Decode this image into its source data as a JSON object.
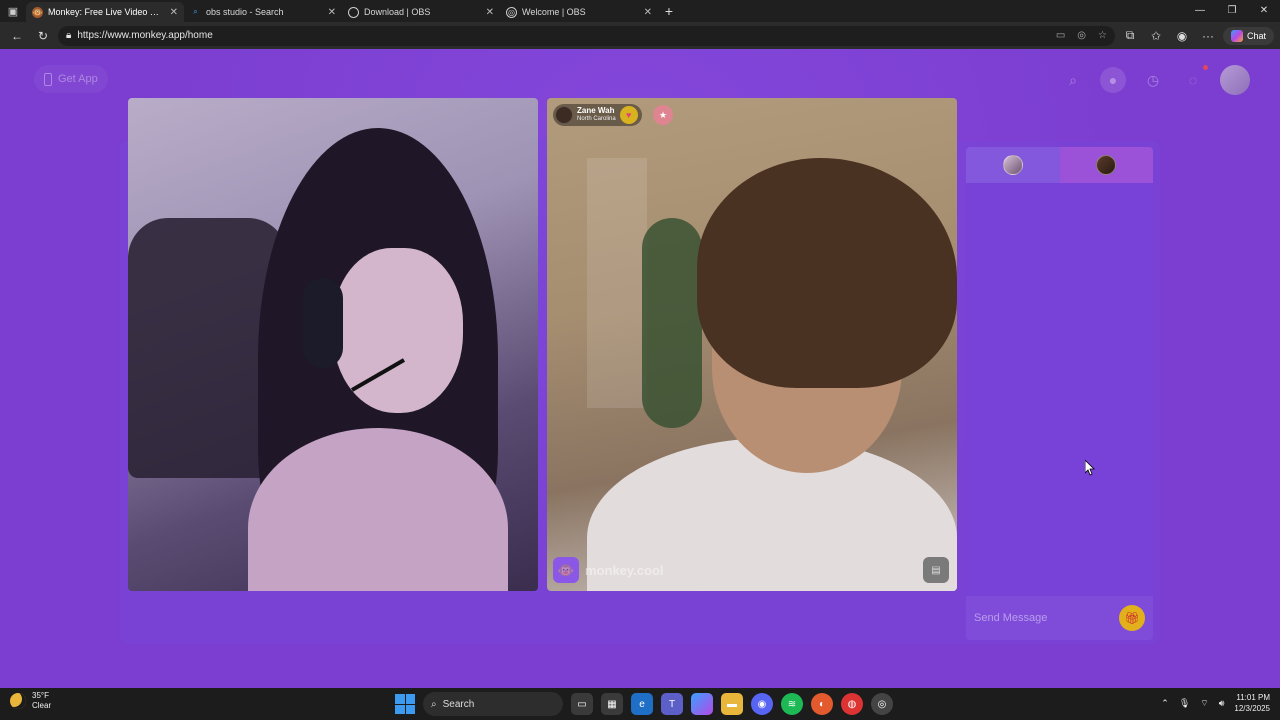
{
  "browser": {
    "tabs": [
      {
        "title": "Monkey: Free Live Video Chat",
        "active": true
      },
      {
        "title": "obs studio - Search",
        "active": false
      },
      {
        "title": "Download | OBS",
        "active": false
      },
      {
        "title": "Welcome | OBS",
        "active": false
      }
    ],
    "url": "https://www.monkey.app/home",
    "chat_label": "Chat"
  },
  "site": {
    "get_app_label": "Get App",
    "remote_user": {
      "name": "Zane Wah",
      "location": "North Carolina"
    },
    "watermark": "monkey.cool",
    "chat_placeholder": "Send Message"
  },
  "taskbar": {
    "weather_temp": "35°F",
    "weather_desc": "Clear",
    "search_label": "Search",
    "time": "11:01 PM",
    "date": "12/3/2025"
  },
  "colors": {
    "page_bg": "#7b3ed0",
    "chat_bg": "#7841d8",
    "gift": "#e2b01a"
  }
}
